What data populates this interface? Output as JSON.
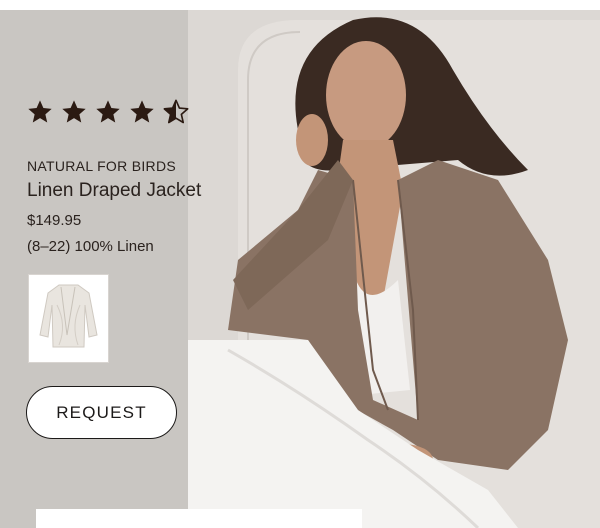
{
  "product": {
    "rating": {
      "value": 4.5,
      "max": 5
    },
    "brand": "NATURAL FOR BIRDS",
    "name": "Linen Draped Jacket",
    "price": "$149.95",
    "details": "(8–22) 100% Linen"
  },
  "actions": {
    "request_label": "REQUEST"
  },
  "colors": {
    "panel": "#c9c6c2",
    "star": "#2b1a12",
    "text": "#2a221e",
    "jacket": "#8a7364"
  },
  "icons": {
    "star": "star-icon",
    "half_star": "star-half-icon"
  }
}
